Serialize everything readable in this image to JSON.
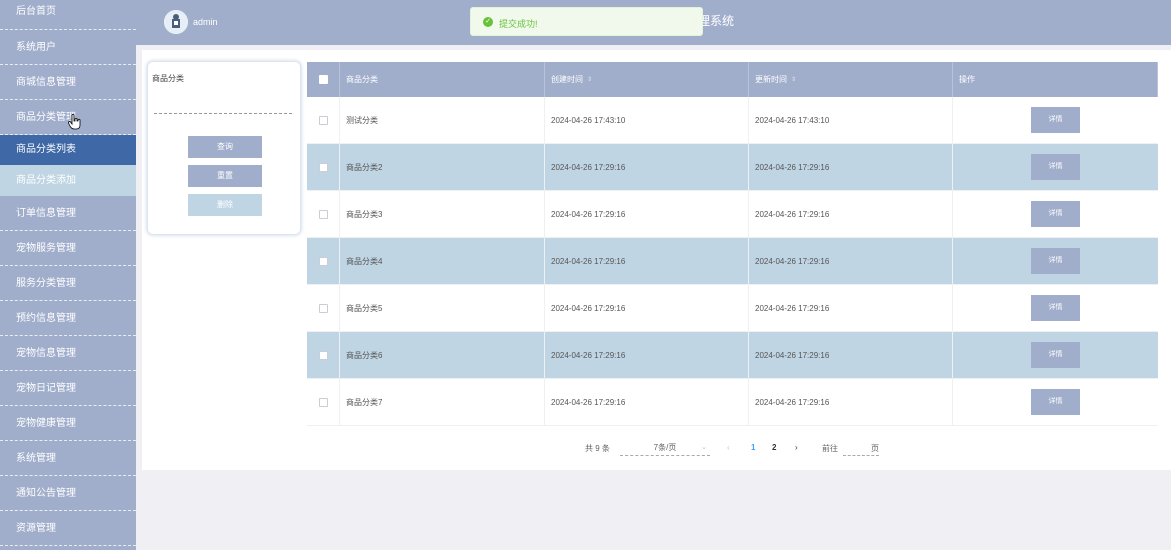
{
  "sidebar": {
    "items": [
      {
        "label": "后台首页"
      },
      {
        "label": "系统用户"
      },
      {
        "label": "商城信息管理"
      },
      {
        "label": "商品分类管理"
      },
      {
        "label": "商品分类列表"
      },
      {
        "label": "商品分类添加"
      },
      {
        "label": "订单信息管理"
      },
      {
        "label": "宠物服务管理"
      },
      {
        "label": "服务分类管理"
      },
      {
        "label": "预约信息管理"
      },
      {
        "label": "宠物信息管理"
      },
      {
        "label": "宠物日记管理"
      },
      {
        "label": "宠物健康管理"
      },
      {
        "label": "系统管理"
      },
      {
        "label": "通知公告管理"
      },
      {
        "label": "资源管理"
      }
    ]
  },
  "header": {
    "username": "admin",
    "system_title": "理系统",
    "avatar_icon": "user-avatar-icon"
  },
  "toast": {
    "message": "提交成功!",
    "icon": "success-check-icon",
    "color": "#67c23a"
  },
  "search": {
    "label": "商品分类",
    "query_button": "查询",
    "reset_button": "重置",
    "delete_button": "删除"
  },
  "table": {
    "headers": {
      "category": "商品分类",
      "created": "创建时间",
      "updated": "更新时间",
      "actions": "操作"
    },
    "rows": [
      {
        "category": "测试分类",
        "created": "2024-04-26 17:43:10",
        "updated": "2024-04-26 17:43:10",
        "action": "详情"
      },
      {
        "category": "商品分类2",
        "created": "2024-04-26 17:29:16",
        "updated": "2024-04-26 17:29:16",
        "action": "详情"
      },
      {
        "category": "商品分类3",
        "created": "2024-04-26 17:29:16",
        "updated": "2024-04-26 17:29:16",
        "action": "详情"
      },
      {
        "category": "商品分类4",
        "created": "2024-04-26 17:29:16",
        "updated": "2024-04-26 17:29:16",
        "action": "详情"
      },
      {
        "category": "商品分类5",
        "created": "2024-04-26 17:29:16",
        "updated": "2024-04-26 17:29:16",
        "action": "详情"
      },
      {
        "category": "商品分类6",
        "created": "2024-04-26 17:29:16",
        "updated": "2024-04-26 17:29:16",
        "action": "详情"
      },
      {
        "category": "商品分类7",
        "created": "2024-04-26 17:29:16",
        "updated": "2024-04-26 17:29:16",
        "action": "详情"
      }
    ]
  },
  "pagination": {
    "total": "共 9 条",
    "page_size": "7条/页",
    "pages": [
      "1",
      "2"
    ],
    "current_page": "1",
    "goto_label": "前往",
    "page_suffix": "页"
  },
  "colors": {
    "primary": "#a0aecb",
    "active_menu": "#3e68a6",
    "sub_menu": "#c0d5e4",
    "row_alt": "#c0d5e4"
  }
}
